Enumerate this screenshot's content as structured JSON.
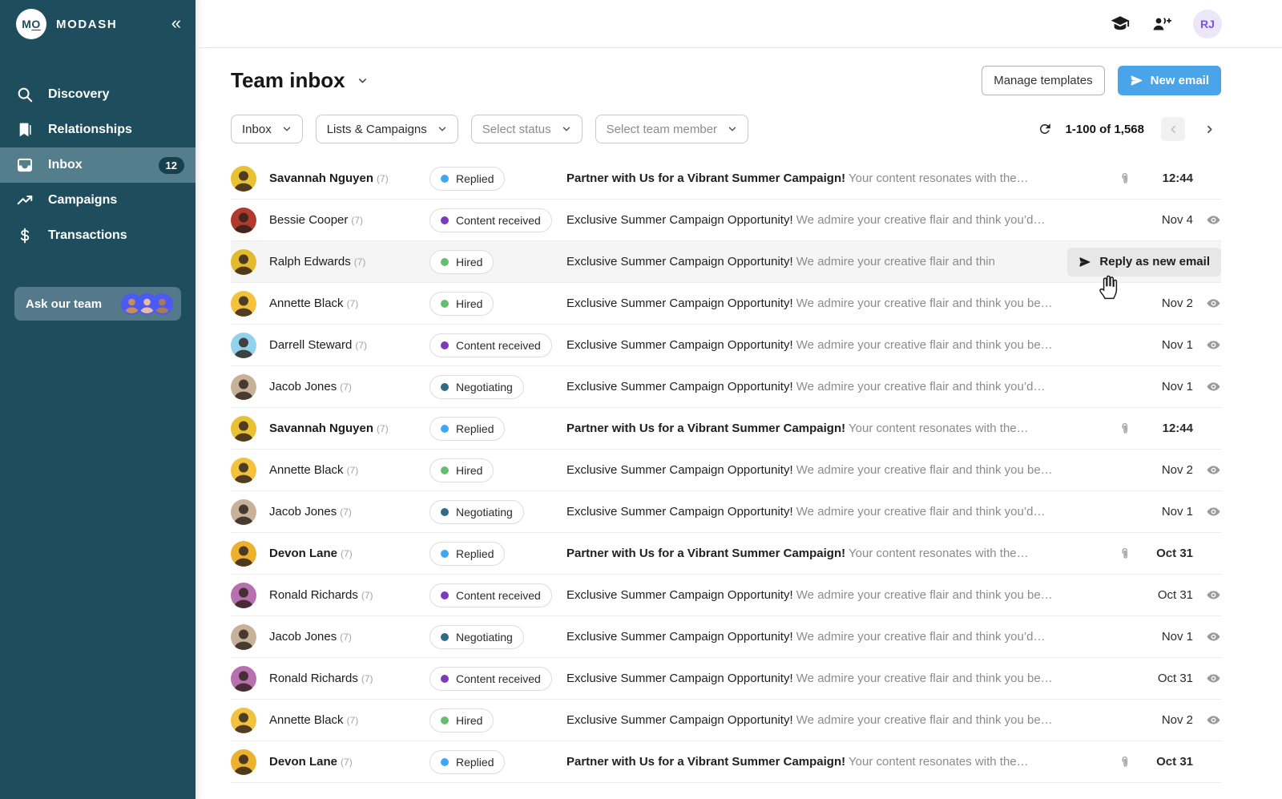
{
  "sidebar": {
    "brand": "MODASH",
    "logo_m": "M",
    "logo_o": "O",
    "items": [
      {
        "label": "Discovery",
        "icon": "search-icon"
      },
      {
        "label": "Relationships",
        "icon": "bookmark-icon"
      },
      {
        "label": "Inbox",
        "icon": "inbox-icon",
        "badge": "12",
        "active": true
      },
      {
        "label": "Campaigns",
        "icon": "trending-up-icon"
      },
      {
        "label": "Transactions",
        "icon": "dollar-icon"
      }
    ],
    "ask_team_label": "Ask our team",
    "team_avatar_skins": [
      "#c98d5a",
      "#e3bda4",
      "#a9795c"
    ]
  },
  "topbar": {
    "user_initials": "RJ"
  },
  "header": {
    "title": "Team inbox",
    "manage_templates_label": "Manage templates",
    "new_email_label": "New email"
  },
  "filters": {
    "folder": "Inbox",
    "lists": "Lists & Campaigns",
    "status_placeholder": "Select status",
    "team_member_placeholder": "Select team member"
  },
  "pagination": {
    "range_label": "1-100 of 1,568"
  },
  "hover_action_label": "Reply as new email",
  "status_colors": {
    "Replied": "#41a7f2",
    "Content received": "#7a3cb8",
    "Hired": "#68bd6d",
    "Negotiating": "#2e6b85"
  },
  "avatar_colors": {
    "savannah": "#e9c133",
    "bessie": "#b03a2e",
    "ralph": "#e3b92e",
    "annette": "#f2c23e",
    "darrell": "#93d2ec",
    "jacob": "#c7b299",
    "devon": "#ecb22e",
    "ronald": "#b670b0"
  },
  "emails": [
    {
      "name": "Savannah Nguyen",
      "count": "(7)",
      "status": "Replied",
      "unread": true,
      "subject": "Partner with Us for a Vibrant Summer Campaign!",
      "preview": "Your content resonates with the…",
      "date": "12:44",
      "attachment": true,
      "eye": false,
      "hovered": false,
      "avatar": "savannah"
    },
    {
      "name": "Bessie Cooper",
      "count": "(7)",
      "status": "Content received",
      "unread": false,
      "subject": "Exclusive Summer Campaign Opportunity!",
      "preview": "We admire your creative flair and think you’d…",
      "date": "Nov 4",
      "attachment": false,
      "eye": true,
      "hovered": false,
      "avatar": "bessie"
    },
    {
      "name": "Ralph Edwards",
      "count": "(7)",
      "status": "Hired",
      "unread": false,
      "subject": "Exclusive Summer Campaign Opportunity!",
      "preview": "We admire your creative flair and thin",
      "date": "",
      "attachment": false,
      "eye": false,
      "hovered": true,
      "avatar": "ralph"
    },
    {
      "name": "Annette Black",
      "count": "(7)",
      "status": "Hired",
      "unread": false,
      "subject": "Exclusive Summer Campaign Opportunity!",
      "preview": "We admire your creative flair and think you be…",
      "date": "Nov 2",
      "attachment": false,
      "eye": true,
      "hovered": false,
      "avatar": "annette"
    },
    {
      "name": "Darrell Steward",
      "count": "(7)",
      "status": "Content received",
      "unread": false,
      "subject": "Exclusive Summer Campaign Opportunity!",
      "preview": "We admire your creative flair and think you be…",
      "date": "Nov 1",
      "attachment": false,
      "eye": true,
      "hovered": false,
      "avatar": "darrell"
    },
    {
      "name": "Jacob Jones",
      "count": "(7)",
      "status": "Negotiating",
      "unread": false,
      "subject": "Exclusive Summer Campaign Opportunity!",
      "preview": "We admire your creative flair and think you’d…",
      "date": "Nov 1",
      "attachment": false,
      "eye": true,
      "hovered": false,
      "avatar": "jacob"
    },
    {
      "name": "Savannah Nguyen",
      "count": "(7)",
      "status": "Replied",
      "unread": true,
      "subject": "Partner with Us for a Vibrant Summer Campaign!",
      "preview": "Your content resonates with the…",
      "date": "12:44",
      "attachment": true,
      "eye": false,
      "hovered": false,
      "avatar": "savannah"
    },
    {
      "name": "Annette Black",
      "count": "(7)",
      "status": "Hired",
      "unread": false,
      "subject": "Exclusive Summer Campaign Opportunity!",
      "preview": "We admire your creative flair and think you be…",
      "date": "Nov 2",
      "attachment": false,
      "eye": true,
      "hovered": false,
      "avatar": "annette"
    },
    {
      "name": "Jacob Jones",
      "count": "(7)",
      "status": "Negotiating",
      "unread": false,
      "subject": "Exclusive Summer Campaign Opportunity!",
      "preview": "We admire your creative flair and think you’d…",
      "date": "Nov 1",
      "attachment": false,
      "eye": true,
      "hovered": false,
      "avatar": "jacob"
    },
    {
      "name": "Devon Lane",
      "count": "(7)",
      "status": "Replied",
      "unread": true,
      "subject": "Partner with Us for a Vibrant Summer Campaign!",
      "preview": "Your content resonates with the…",
      "date": "Oct 31",
      "attachment": true,
      "eye": false,
      "hovered": false,
      "avatar": "devon"
    },
    {
      "name": "Ronald Richards",
      "count": "(7)",
      "status": "Content received",
      "unread": false,
      "subject": "Exclusive Summer Campaign Opportunity!",
      "preview": "We admire your creative flair and think you be…",
      "date": "Oct 31",
      "attachment": false,
      "eye": true,
      "hovered": false,
      "avatar": "ronald"
    },
    {
      "name": "Jacob Jones",
      "count": "(7)",
      "status": "Negotiating",
      "unread": false,
      "subject": "Exclusive Summer Campaign Opportunity!",
      "preview": "We admire your creative flair and think you’d…",
      "date": "Nov 1",
      "attachment": false,
      "eye": true,
      "hovered": false,
      "avatar": "jacob"
    },
    {
      "name": "Ronald Richards",
      "count": "(7)",
      "status": "Content received",
      "unread": false,
      "subject": "Exclusive Summer Campaign Opportunity!",
      "preview": "We admire your creative flair and think you be…",
      "date": "Oct 31",
      "attachment": false,
      "eye": true,
      "hovered": false,
      "avatar": "ronald"
    },
    {
      "name": "Annette Black",
      "count": "(7)",
      "status": "Hired",
      "unread": false,
      "subject": "Exclusive Summer Campaign Opportunity!",
      "preview": "We admire your creative flair and think you be…",
      "date": "Nov 2",
      "attachment": false,
      "eye": true,
      "hovered": false,
      "avatar": "annette"
    },
    {
      "name": "Devon Lane",
      "count": "(7)",
      "status": "Replied",
      "unread": true,
      "subject": "Partner with Us for a Vibrant Summer Campaign!",
      "preview": "Your content resonates with the…",
      "date": "Oct 31",
      "attachment": true,
      "eye": false,
      "hovered": false,
      "avatar": "devon"
    }
  ]
}
